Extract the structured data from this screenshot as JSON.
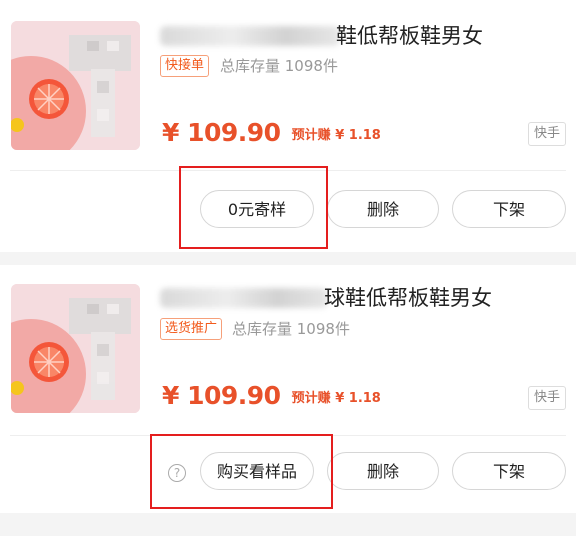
{
  "products": [
    {
      "title": "鞋低帮板鞋男女",
      "tag": "快接单",
      "stock": "总库存量 1098件",
      "price": "¥ 109.90",
      "earn": "预计赚 ¥ 1.18",
      "platform": "快手",
      "buttons": {
        "sample": "0元寄样",
        "delete": "删除",
        "off": "下架"
      }
    },
    {
      "title": "球鞋低帮板鞋男女",
      "tag": "选货推广",
      "stock": "总库存量 1098件",
      "price": "¥ 109.90",
      "earn": "预计赚 ¥ 1.18",
      "platform": "快手",
      "help_icon": "?",
      "buttons": {
        "sample": "购买看样品",
        "delete": "删除",
        "off": "下架"
      }
    }
  ],
  "colors": {
    "accent": "#e8512a",
    "tag_text": "#f25a1c",
    "highlight": "#e41e1e"
  },
  "icons": [
    "help-icon",
    "product-image"
  ]
}
